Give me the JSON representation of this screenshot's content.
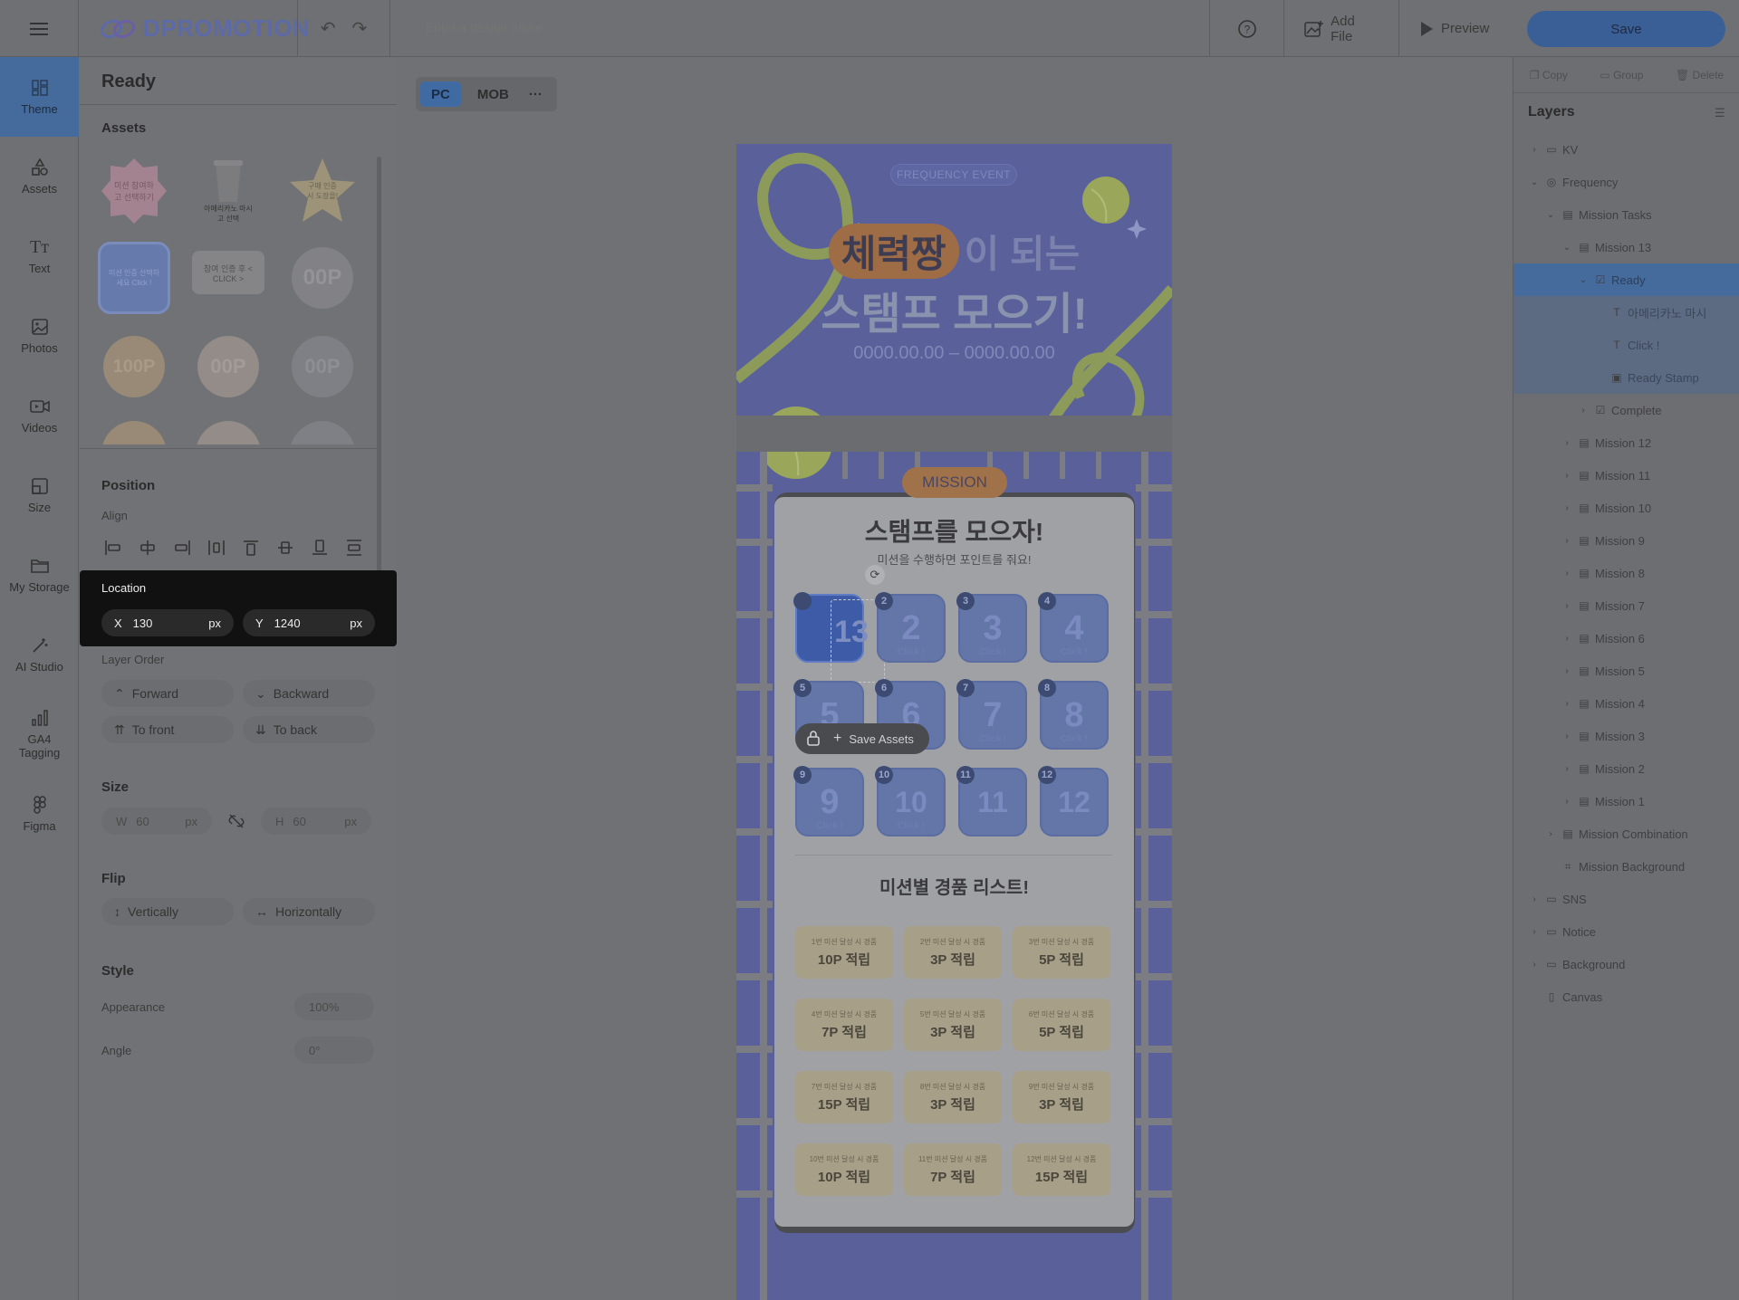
{
  "topbar": {
    "logo": "DPROMOTION",
    "design_name_placeholder": "Enter a design name",
    "add_file": "Add File",
    "preview": "Preview",
    "save": "Save"
  },
  "rail": [
    {
      "label": "Theme",
      "icon": "theme-icon",
      "active": true
    },
    {
      "label": "Assets",
      "icon": "shapes-icon"
    },
    {
      "label": "Text",
      "icon": "text-icon"
    },
    {
      "label": "Photos",
      "icon": "photo-icon"
    },
    {
      "label": "Videos",
      "icon": "video-icon"
    },
    {
      "label": "Size",
      "icon": "resize-icon"
    },
    {
      "label": "My Storage",
      "icon": "folder-icon"
    },
    {
      "label": "AI Studio",
      "icon": "magic-wand-icon"
    },
    {
      "label": "GA4 Tagging",
      "icon": "chart-icon"
    },
    {
      "label": "Figma",
      "icon": "figma-icon"
    }
  ],
  "panel": {
    "title": "Ready",
    "assets_title": "Assets",
    "assets": [
      "미션 참여하고 선택하기",
      "아메리카노 마시고 선택",
      "구매 인증 시 도장을!",
      "미션 인증 선택하세요 Click !",
      "참여 인증 후 < CLICK >",
      "00P",
      "100P",
      "00P",
      "00P"
    ],
    "position_title": "Position",
    "align_label": "Align",
    "location_title": "Location",
    "x_label": "X",
    "x_value": "130",
    "x_unit": "px",
    "y_label": "Y",
    "y_value": "1240",
    "y_unit": "px",
    "layer_order_label": "Layer Order",
    "forward": "Forward",
    "backward": "Backward",
    "to_front": "To front",
    "to_back": "To back",
    "size_title": "Size",
    "w_label": "W",
    "w_value": "60",
    "w_unit": "px",
    "h_label": "H",
    "h_value": "60",
    "h_unit": "px",
    "flip_title": "Flip",
    "vertically": "Vertically",
    "horizontally": "Horizontally",
    "style_title": "Style",
    "appearance_label": "Appearance",
    "appearance_value": "100%",
    "angle_label": "Angle",
    "angle_value": "0°"
  },
  "view_tabs": {
    "pc": "PC",
    "mob": "MOB"
  },
  "design": {
    "badge": "FREQUENCY EVENT",
    "headline_pill": "체력짱",
    "headline_rest": "이 되는",
    "headline2": "스탬프 모으기!",
    "dates": "0000.00.00 – 0000.00.00",
    "mission_pill": "MISSION",
    "card_title": "스탬프를 모으자!",
    "card_sub": "미션을 수행하면 포인트를 줘요!",
    "stamps": [
      "13",
      "2",
      "3",
      "4",
      "5",
      "6",
      "7",
      "8",
      "9",
      "10",
      "11",
      "12"
    ],
    "stamp_click": "Click !",
    "save_assets": "Save Assets",
    "gift_title": "미션별 경품 리스트!",
    "gifts": [
      {
        "t": "1번 미션 달성 시 경품",
        "p": "10P 적립"
      },
      {
        "t": "2번 미션 달성 시 경품",
        "p": "3P 적립"
      },
      {
        "t": "3번 미션 달성 시 경품",
        "p": "5P 적립"
      },
      {
        "t": "4번 미션 달성 시 경품",
        "p": "7P 적립"
      },
      {
        "t": "5번 미션 달성 시 경품",
        "p": "3P 적립"
      },
      {
        "t": "6번 미션 달성 시 경품",
        "p": "5P 적립"
      },
      {
        "t": "7번 미션 달성 시 경품",
        "p": "15P 적립"
      },
      {
        "t": "8번 미션 달성 시 경품",
        "p": "3P 적립"
      },
      {
        "t": "9번 미션 달성 시 경품",
        "p": "3P 적립"
      },
      {
        "t": "10번 미션 달성 시 경품",
        "p": "10P 적립"
      },
      {
        "t": "11번 미션 달성 시 경품",
        "p": "7P 적립"
      },
      {
        "t": "12번 미션 달성 시 경품",
        "p": "15P 적립"
      }
    ]
  },
  "layers_panel": {
    "actions": [
      "Copy",
      "Group",
      "Delete"
    ],
    "title": "Layers",
    "items": [
      {
        "label": "KV",
        "indent": 0,
        "arrow": "›",
        "icon": "folder-icon",
        "state": ""
      },
      {
        "label": "Frequency",
        "indent": 0,
        "arrow": "⌄",
        "icon": "globe-icon",
        "state": ""
      },
      {
        "label": "Mission Tasks",
        "indent": 1,
        "arrow": "⌄",
        "icon": "list-icon",
        "state": ""
      },
      {
        "label": "Mission 13",
        "indent": 2,
        "arrow": "⌄",
        "icon": "list-icon",
        "state": ""
      },
      {
        "label": "Ready",
        "indent": 3,
        "arrow": "⌄",
        "icon": "checkbox-icon",
        "state": "sel"
      },
      {
        "label": "아메리카노 마시",
        "indent": 4,
        "arrow": "",
        "icon": "text-icon",
        "state": "child"
      },
      {
        "label": "Click !",
        "indent": 4,
        "arrow": "",
        "icon": "text-icon",
        "state": "child"
      },
      {
        "label": "Ready Stamp",
        "indent": 4,
        "arrow": "",
        "icon": "image-icon",
        "state": "child"
      },
      {
        "label": "Complete",
        "indent": 3,
        "arrow": "›",
        "icon": "checkbox-icon",
        "state": ""
      },
      {
        "label": "Mission 12",
        "indent": 2,
        "arrow": "›",
        "icon": "list-icon",
        "state": ""
      },
      {
        "label": "Mission 11",
        "indent": 2,
        "arrow": "›",
        "icon": "list-icon",
        "state": ""
      },
      {
        "label": "Mission 10",
        "indent": 2,
        "arrow": "›",
        "icon": "list-icon",
        "state": ""
      },
      {
        "label": "Mission 9",
        "indent": 2,
        "arrow": "›",
        "icon": "list-icon",
        "state": ""
      },
      {
        "label": "Mission 8",
        "indent": 2,
        "arrow": "›",
        "icon": "list-icon",
        "state": ""
      },
      {
        "label": "Mission 7",
        "indent": 2,
        "arrow": "›",
        "icon": "list-icon",
        "state": ""
      },
      {
        "label": "Mission 6",
        "indent": 2,
        "arrow": "›",
        "icon": "list-icon",
        "state": ""
      },
      {
        "label": "Mission 5",
        "indent": 2,
        "arrow": "›",
        "icon": "list-icon",
        "state": ""
      },
      {
        "label": "Mission 4",
        "indent": 2,
        "arrow": "›",
        "icon": "list-icon",
        "state": ""
      },
      {
        "label": "Mission 3",
        "indent": 2,
        "arrow": "›",
        "icon": "list-icon",
        "state": ""
      },
      {
        "label": "Mission 2",
        "indent": 2,
        "arrow": "›",
        "icon": "list-icon",
        "state": ""
      },
      {
        "label": "Mission 1",
        "indent": 2,
        "arrow": "›",
        "icon": "list-icon",
        "state": ""
      },
      {
        "label": "Mission Combination",
        "indent": 1,
        "arrow": "›",
        "icon": "stack-icon",
        "state": ""
      },
      {
        "label": "Mission Background",
        "indent": 1,
        "arrow": "",
        "icon": "frame-icon",
        "state": ""
      },
      {
        "label": "SNS",
        "indent": 0,
        "arrow": "›",
        "icon": "folder-icon",
        "state": ""
      },
      {
        "label": "Notice",
        "indent": 0,
        "arrow": "›",
        "icon": "folder-icon",
        "state": ""
      },
      {
        "label": "Background",
        "indent": 0,
        "arrow": "›",
        "icon": "folder-icon",
        "state": ""
      },
      {
        "label": "Canvas",
        "indent": 0,
        "arrow": "",
        "icon": "page-icon",
        "state": ""
      }
    ]
  }
}
